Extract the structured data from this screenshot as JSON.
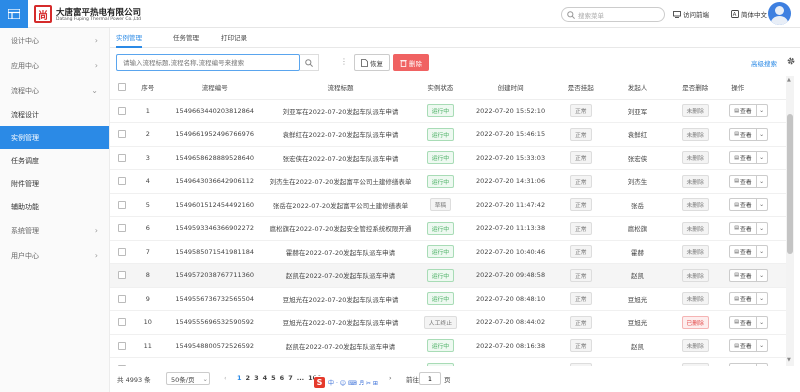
{
  "header": {
    "company_cn": "大唐富平热电有限公司",
    "company_en": "Datang Fuping Thermal Power Co.,Ltd",
    "logo_char": "尚",
    "search_placeholder": "搜索菜单",
    "feedback": "访问前端",
    "lang": "简体中文"
  },
  "sidebar": {
    "groups_top": [
      {
        "label": "设计中心"
      },
      {
        "label": "应用中心"
      },
      {
        "label": "流程中心"
      }
    ],
    "items": [
      {
        "label": "流程设计",
        "active": false
      },
      {
        "label": "实例管理",
        "active": true
      },
      {
        "label": "任务调度",
        "active": false
      },
      {
        "label": "附件管理",
        "active": false
      },
      {
        "label": "辅助功能",
        "active": false
      }
    ],
    "groups_bottom": [
      {
        "label": "系统管理"
      },
      {
        "label": "用户中心"
      }
    ]
  },
  "tabs": [
    {
      "label": "实例管理",
      "active": true
    },
    {
      "label": "任务管理",
      "active": false
    },
    {
      "label": "打印记录",
      "active": false
    }
  ],
  "toolbar": {
    "keyword_placeholder": "请输入流程标题,流程名称,流程编号来搜索",
    "restore_label": "恢复",
    "delete_label": "删除",
    "advanced_search": "高级搜索"
  },
  "table": {
    "columns": [
      "序号",
      "流程编号",
      "流程标题",
      "实例状态",
      "创建时间",
      "是否挂起",
      "发起人",
      "是否删除",
      "操作"
    ],
    "action_label": "查看",
    "rows": [
      {
        "no": "1",
        "id": "1549663440203812864",
        "title": "刘亚军在2022-07-20发起车队派车申请",
        "status": "运行中",
        "status_type": "green",
        "time": "2022-07-20 15:52:10",
        "suspend": "正常",
        "initiator": "刘亚军",
        "deleted": "未删除",
        "deleted_type": "gray"
      },
      {
        "no": "2",
        "id": "1549661952496766976",
        "title": "袁鲜红在2022-07-20发起车队派车申请",
        "status": "运行中",
        "status_type": "green",
        "time": "2022-07-20 15:46:15",
        "suspend": "正常",
        "initiator": "袁鲜红",
        "deleted": "未删除",
        "deleted_type": "gray"
      },
      {
        "no": "3",
        "id": "1549658628889528640",
        "title": "张宏侠在2022-07-20发起车队派车申请",
        "status": "运行中",
        "status_type": "green",
        "time": "2022-07-20 15:33:03",
        "suspend": "正常",
        "initiator": "张宏侠",
        "deleted": "未删除",
        "deleted_type": "gray"
      },
      {
        "no": "4",
        "id": "1549643036642906112",
        "title": "刘杰生在2022-07-20发起富平公司土建修缮表单",
        "status": "运行中",
        "status_type": "green",
        "time": "2022-07-20 14:31:06",
        "suspend": "正常",
        "initiator": "刘杰生",
        "deleted": "未删除",
        "deleted_type": "gray"
      },
      {
        "no": "5",
        "id": "1549601512454492160",
        "title": "张岳在2022-07-20发起富平公司土建修缮表单",
        "status": "草稿",
        "status_type": "gray",
        "time": "2022-07-20 11:47:42",
        "suspend": "正常",
        "initiator": "张岳",
        "deleted": "未删除",
        "deleted_type": "gray"
      },
      {
        "no": "6",
        "id": "1549593346366902272",
        "title": "扈松旗在2022-07-20发起安全管控系统权限开通",
        "status": "运行中",
        "status_type": "green",
        "time": "2022-07-20 11:13:38",
        "suspend": "正常",
        "initiator": "扈松旗",
        "deleted": "未删除",
        "deleted_type": "gray"
      },
      {
        "no": "7",
        "id": "1549585071541981184",
        "title": "霍赫在2022-07-20发起车队派车申请",
        "status": "运行中",
        "status_type": "green",
        "time": "2022-07-20 10:40:46",
        "suspend": "正常",
        "initiator": "霍赫",
        "deleted": "未删除",
        "deleted_type": "gray"
      },
      {
        "no": "8",
        "id": "1549572038767711360",
        "title": "赵凯在2022-07-20发起车队派车申请",
        "status": "运行中",
        "status_type": "green",
        "time": "2022-07-20 09:48:58",
        "suspend": "正常",
        "initiator": "赵凯",
        "deleted": "未删除",
        "deleted_type": "gray"
      },
      {
        "no": "9",
        "id": "1549556736732565504",
        "title": "豆旭光在2022-07-20发起车队派车申请",
        "status": "运行中",
        "status_type": "green",
        "time": "2022-07-20 08:48:10",
        "suspend": "正常",
        "initiator": "豆旭光",
        "deleted": "未删除",
        "deleted_type": "gray"
      },
      {
        "no": "10",
        "id": "1549555696532590592",
        "title": "豆旭光在2022-07-20发起车队派车申请",
        "status": "人工终止",
        "status_type": "gray",
        "time": "2022-07-20 08:44:02",
        "suspend": "正常",
        "initiator": "豆旭光",
        "deleted": "已删除",
        "deleted_type": "red"
      },
      {
        "no": "11",
        "id": "1549548800572526592",
        "title": "赵凯在2022-07-20发起车队派车申请",
        "status": "运行中",
        "status_type": "green",
        "time": "2022-07-20 08:16:38",
        "suspend": "正常",
        "initiator": "赵凯",
        "deleted": "未删除",
        "deleted_type": "gray"
      },
      {
        "no": "12",
        "id": "1549428352739944480",
        "title": "张琨在2022-07-19发起公务接待审批表",
        "status": "运行中",
        "status_type": "green",
        "time": "2022-07-19 14:42:32",
        "suspend": "正常",
        "initiator": "张琨",
        "deleted": "未删除",
        "deleted_type": "gray"
      },
      {
        "no": "13",
        "id": "1549423201496407302",
        "title": "张琨在2022-07-19发起车队派车申请",
        "status": "运行中",
        "status_type": "green",
        "time": "2022-07-19 14:22:18",
        "suspend": "正常",
        "initiator": "张琨",
        "deleted": "未删除",
        "deleted_type": "gray"
      }
    ]
  },
  "pagination": {
    "total": "共 4993 条",
    "page_size": "50条/页",
    "pages": [
      "1",
      "2",
      "3",
      "4",
      "5",
      "6",
      "7",
      "...",
      "100"
    ],
    "current": "1",
    "goto_label": "前往",
    "goto_value": "1",
    "page_word": "页"
  },
  "ime": {
    "logo": "S",
    "items": [
      "中",
      "·",
      "☺",
      "⌨",
      "♬",
      "✂",
      "⊞"
    ]
  }
}
